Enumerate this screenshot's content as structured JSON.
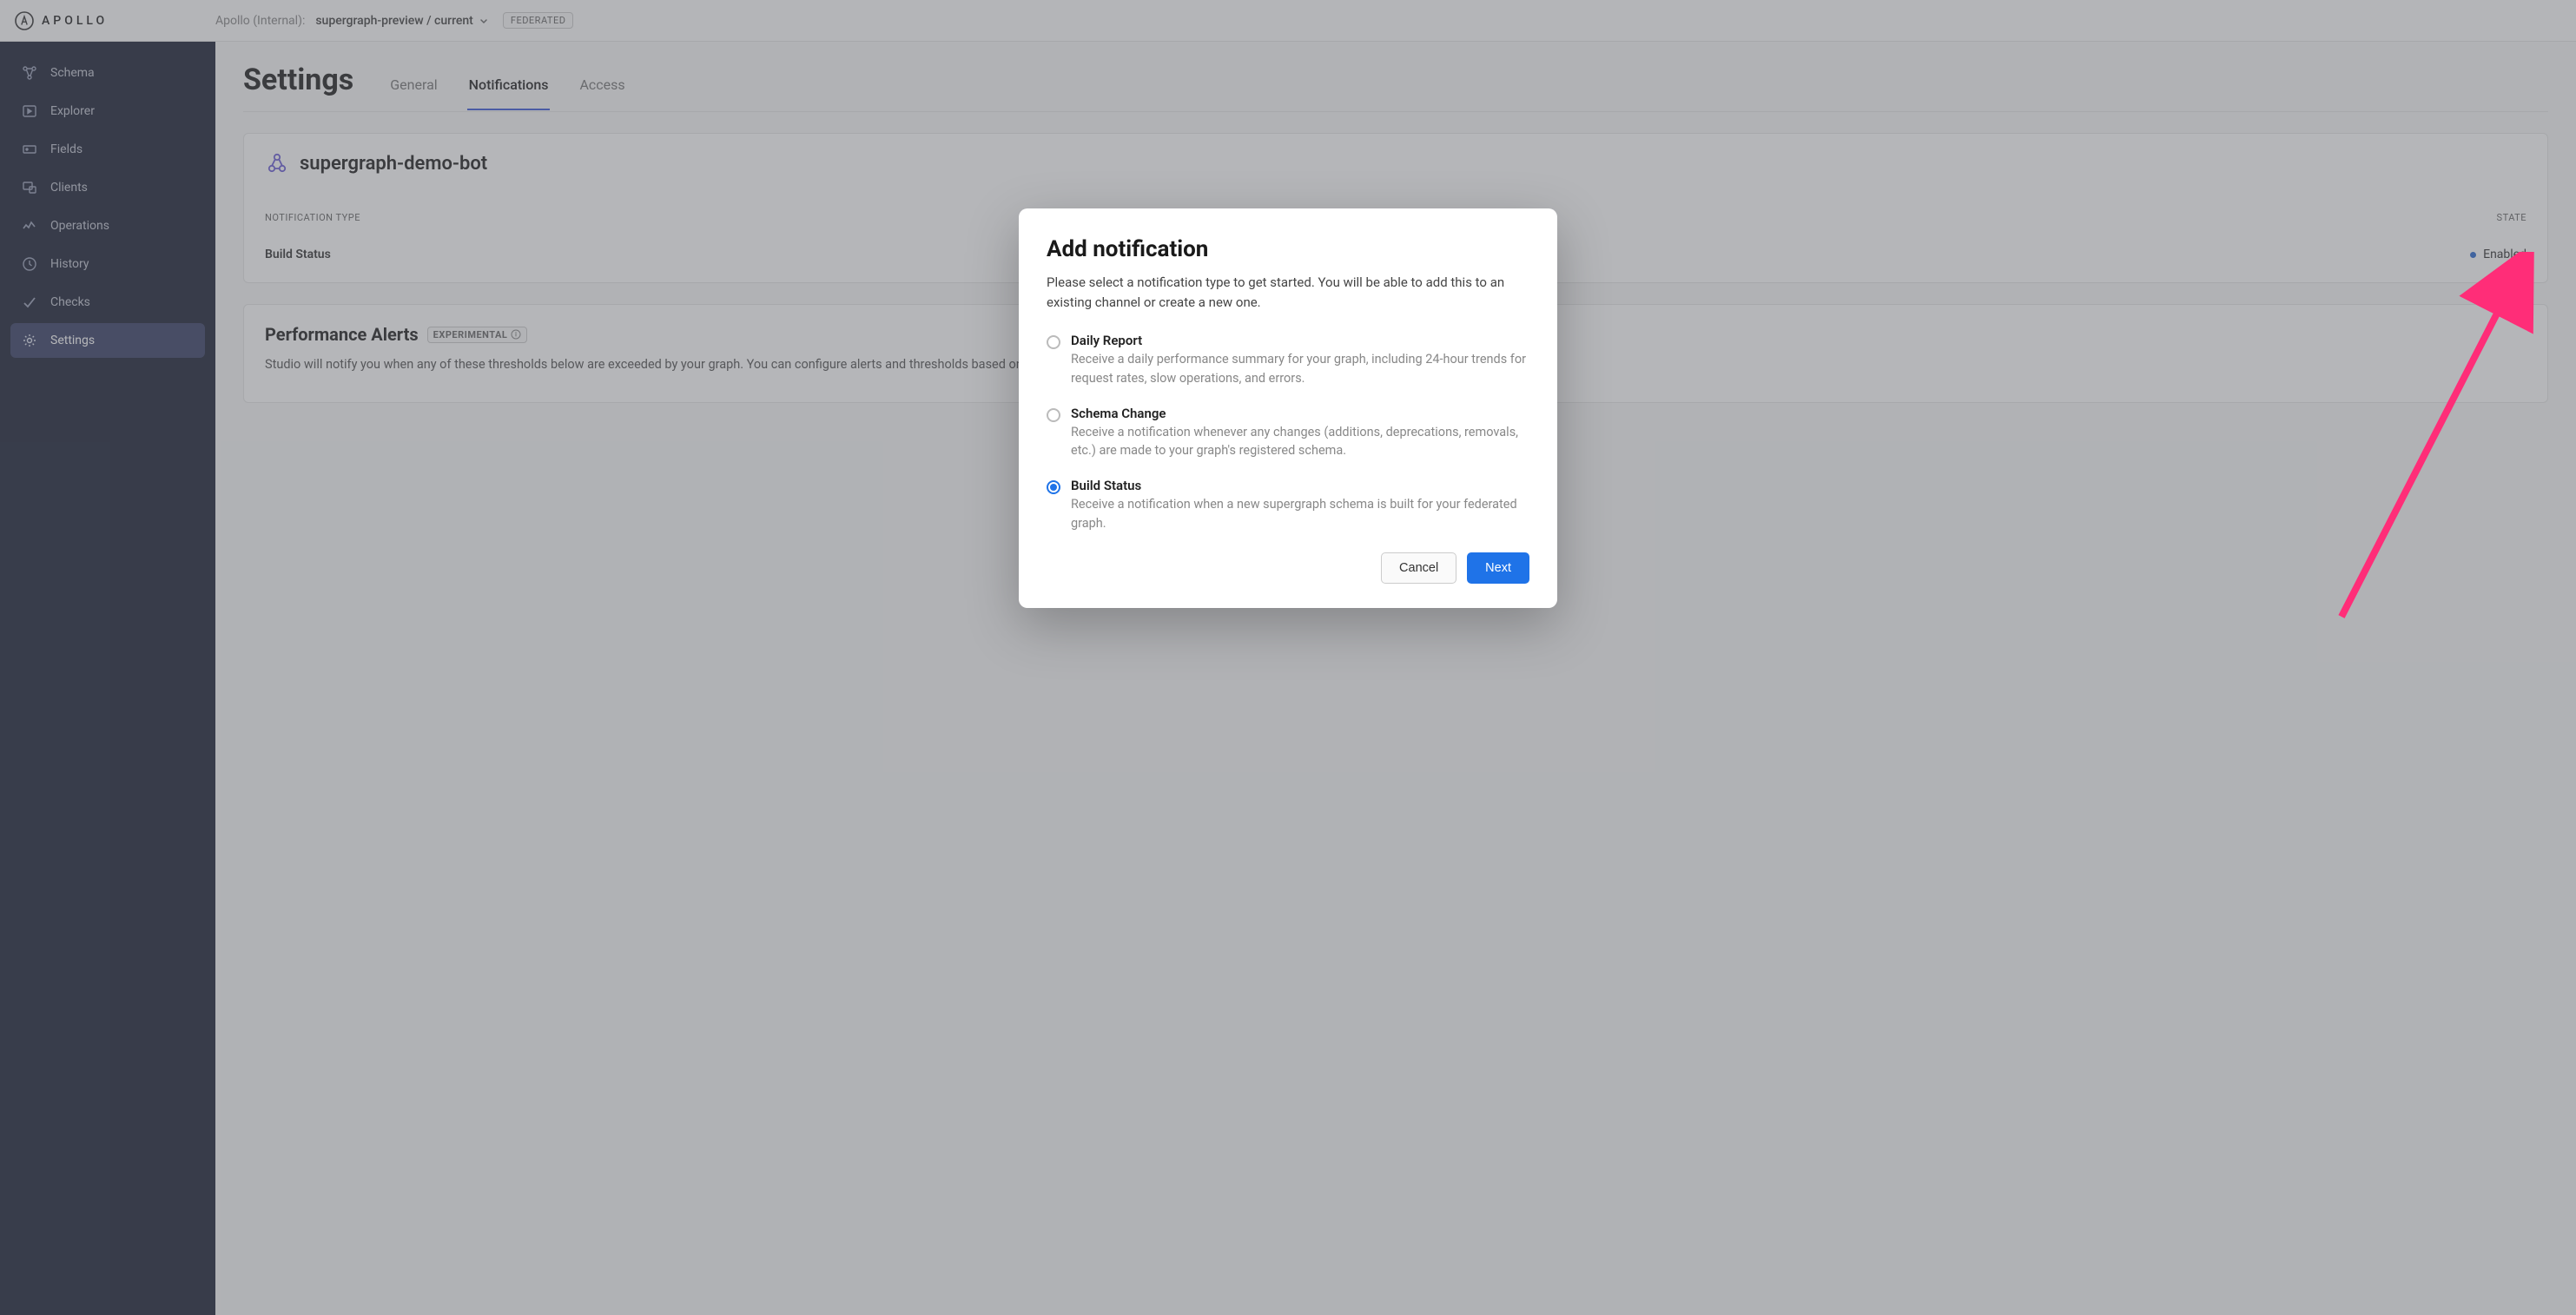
{
  "topbar": {
    "logo_text": "APOLLO",
    "org_label": "Apollo (Internal):",
    "graph_name": "supergraph-preview / current",
    "federated_badge": "FEDERATED"
  },
  "sidebar": {
    "items": [
      {
        "label": "Schema"
      },
      {
        "label": "Explorer"
      },
      {
        "label": "Fields"
      },
      {
        "label": "Clients"
      },
      {
        "label": "Operations"
      },
      {
        "label": "History"
      },
      {
        "label": "Checks"
      },
      {
        "label": "Settings"
      }
    ]
  },
  "page": {
    "title": "Settings",
    "tabs": {
      "general": "General",
      "notifications": "Notifications",
      "access": "Access"
    }
  },
  "channel_card": {
    "channel_name": "supergraph-demo-bot",
    "col_type": "NOTIFICATION TYPE",
    "col_state": "STATE",
    "row_type": "Build Status",
    "row_state": "Enabled"
  },
  "perf_card": {
    "title": "Performance Alerts",
    "badge": "EXPERIMENTAL",
    "desc": "Studio will notify you when any of these thresholds below are exceeded by your graph. You can configure alerts and thresholds based on operations received from your graph and evaluated over a sliding window of the last..."
  },
  "modal": {
    "title": "Add notification",
    "sub": "Please select a notification type to get started. You will be able to add this to an existing channel or create a new one.",
    "options": [
      {
        "label": "Daily Report",
        "desc": "Receive a daily performance summary for your graph, including 24-hour trends for request rates, slow operations, and errors."
      },
      {
        "label": "Schema Change",
        "desc": "Receive a notification whenever any changes (additions, deprecations, removals, etc.) are made to your graph's registered schema."
      },
      {
        "label": "Build Status",
        "desc": "Receive a notification when a new supergraph schema is built for your federated graph."
      }
    ],
    "cancel": "Cancel",
    "next": "Next"
  }
}
